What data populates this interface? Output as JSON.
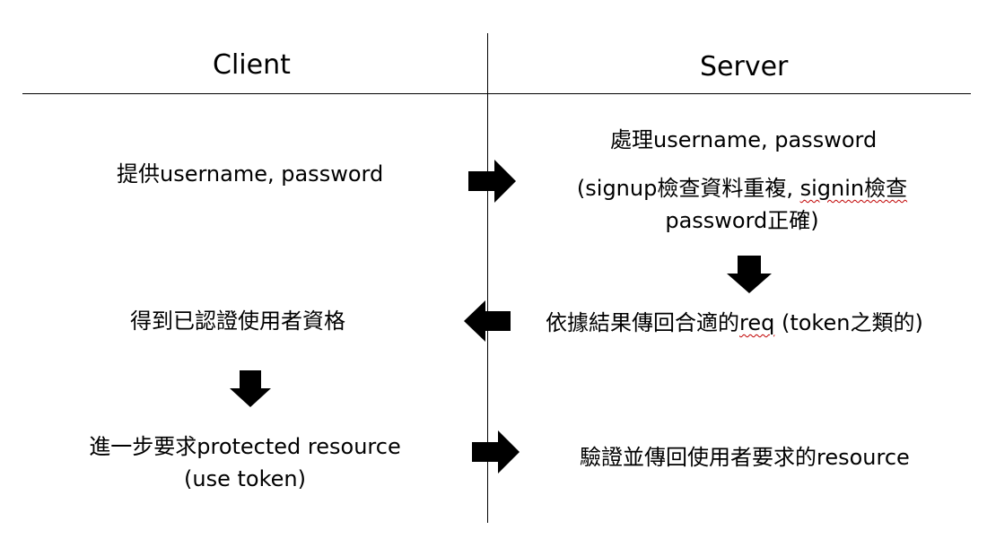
{
  "headers": {
    "client": "Client",
    "server": "Server"
  },
  "steps": {
    "client_provide": "提供username, password",
    "server_process_title": "處理username, password",
    "server_process_detail": {
      "part1": "(signup檢查資料重複, ",
      "part2": "signin檢查",
      "line2": "password正確)"
    },
    "server_response": {
      "part1": "依據結果傳回合適的",
      "part2": "req",
      "part3": " (token之類的)"
    },
    "client_qualified": "得到已認證使用者資格",
    "client_request": {
      "line1": "進一步要求protected resource",
      "line2": "(use token)"
    },
    "server_return": "驗證並傳回使用者要求的resource"
  },
  "arrows": [
    "right-arrow",
    "down-arrow",
    "left-arrow",
    "down-arrow",
    "right-arrow"
  ],
  "colors": {
    "line": "#000000",
    "arrow": "#000000",
    "spellcheck_underline": "#c00000",
    "background": "#ffffff"
  }
}
